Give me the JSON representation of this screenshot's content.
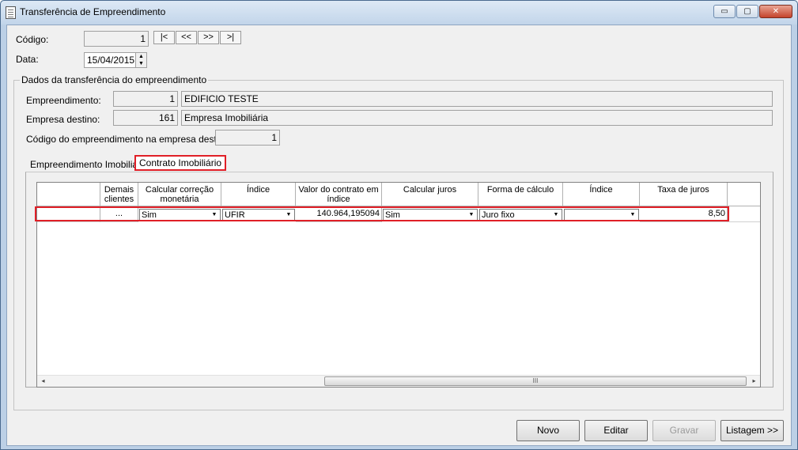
{
  "window": {
    "title": "Transferência de Empreendimento",
    "minimize_label": "▭",
    "maximize_label": "▢",
    "close_label": "✕"
  },
  "form": {
    "codigo_label": "Código:",
    "codigo_value": "1",
    "data_label": "Data:",
    "data_value": "15/04/2015",
    "nav_first": "|<",
    "nav_prev": "<<",
    "nav_next": ">>",
    "nav_last": ">|"
  },
  "group": {
    "legend": "Dados da transferência do empreendimento",
    "empreendimento_label": "Empreendimento:",
    "empreendimento_code": "1",
    "empreendimento_name": "EDIFICIO TESTE",
    "empresa_label": "Empresa destino:",
    "empresa_code": "161",
    "empresa_name": "Empresa Imobiliária",
    "codigo_destino_label": "Código do empreendimento na empresa destino:",
    "codigo_destino_value": "1"
  },
  "tabs": [
    {
      "label": "Empreendimento Imobiliário",
      "active": false
    },
    {
      "label": "Contrato Imobiliário",
      "active": true
    }
  ],
  "grid": {
    "headers": [
      "",
      "Demais clientes",
      "Calcular correção monetária",
      "Índice",
      "Valor do contrato em índice",
      "Calcular juros",
      "Forma de cálculo",
      "Índice",
      "Taxa de juros",
      ""
    ],
    "row": {
      "demais": "...",
      "calc_correcao": "Sim",
      "indice": "UFIR",
      "valor_indice": "140.964,195094",
      "calc_juros": "Sim",
      "forma_calculo": "Juro fixo",
      "indice2": "",
      "taxa_juros": "8,50"
    },
    "scroll_left": "◂",
    "scroll_right": "▸",
    "scroll_grip": "III"
  },
  "buttons": {
    "novo": "Novo",
    "editar": "Editar",
    "gravar": "Gravar",
    "listagem": "Listagem >>"
  },
  "colors": {
    "highlight": "#e01f27",
    "title_bar": "#c2d5ea"
  }
}
